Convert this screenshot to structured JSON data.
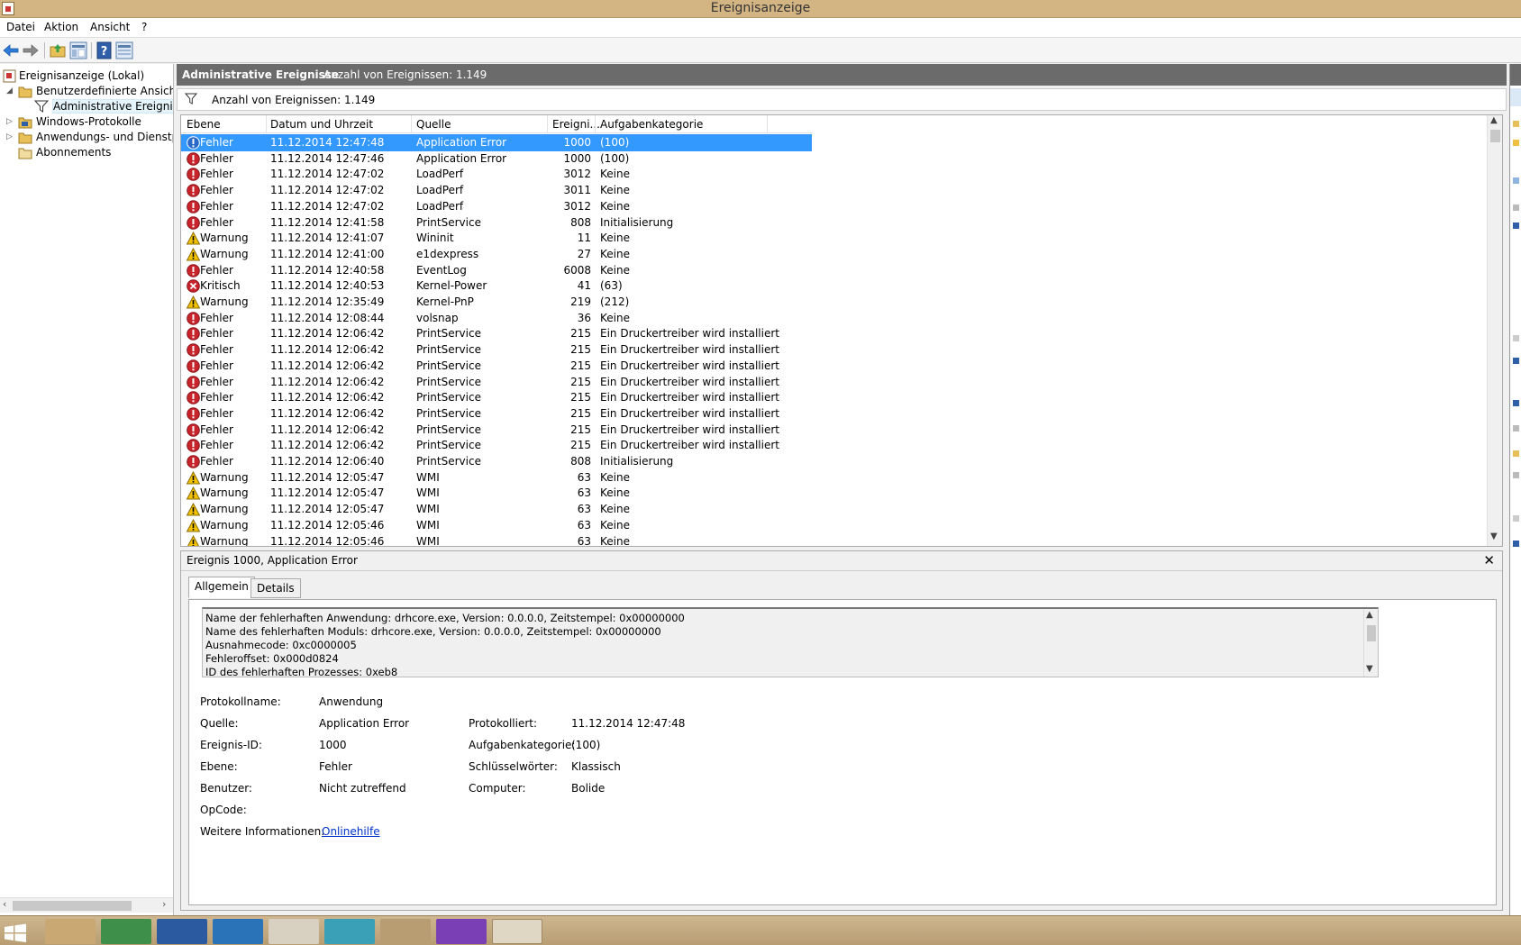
{
  "window": {
    "title": "Ereignisanzeige"
  },
  "menu": [
    "Datei",
    "Aktion",
    "Ansicht",
    "?"
  ],
  "toolbar": {
    "buttons": [
      "back-arrow-icon",
      "forward-arrow-icon",
      "folder-up-icon",
      "show-hide-tree-icon",
      "help-icon",
      "properties-icon"
    ]
  },
  "tree": {
    "root": "Ereignisanzeige (Lokal)",
    "custom_views": "Benutzerdefinierte Ansichten",
    "admin_events": "Administrative Ereignisse",
    "windows_logs": "Windows-Protokolle",
    "app_services": "Anwendungs- und Dienstpro",
    "subscriptions": "Abonnements"
  },
  "center": {
    "header_title": "Administrative Ereignisse",
    "header_count": "Anzahl von Ereignissen: 1.149",
    "filter_text": "Anzahl von Ereignissen: 1.149"
  },
  "columns": [
    "Ebene",
    "Datum und Uhrzeit",
    "Quelle",
    "Ereigni...",
    "Aufgabenkategorie"
  ],
  "events": [
    {
      "level": "Fehler",
      "type": "info-sel",
      "date": "11.12.2014 12:47:48",
      "source": "Application Error",
      "id": "1000",
      "category": "(100)"
    },
    {
      "level": "Fehler",
      "type": "error",
      "date": "11.12.2014 12:47:46",
      "source": "Application Error",
      "id": "1000",
      "category": "(100)"
    },
    {
      "level": "Fehler",
      "type": "error",
      "date": "11.12.2014 12:47:02",
      "source": "LoadPerf",
      "id": "3012",
      "category": "Keine"
    },
    {
      "level": "Fehler",
      "type": "error",
      "date": "11.12.2014 12:47:02",
      "source": "LoadPerf",
      "id": "3011",
      "category": "Keine"
    },
    {
      "level": "Fehler",
      "type": "error",
      "date": "11.12.2014 12:47:02",
      "source": "LoadPerf",
      "id": "3012",
      "category": "Keine"
    },
    {
      "level": "Fehler",
      "type": "error",
      "date": "11.12.2014 12:41:58",
      "source": "PrintService",
      "id": "808",
      "category": "Initialisierung"
    },
    {
      "level": "Warnung",
      "type": "warning",
      "date": "11.12.2014 12:41:07",
      "source": "Wininit",
      "id": "11",
      "category": "Keine"
    },
    {
      "level": "Warnung",
      "type": "warning",
      "date": "11.12.2014 12:41:00",
      "source": "e1dexpress",
      "id": "27",
      "category": "Keine"
    },
    {
      "level": "Fehler",
      "type": "error",
      "date": "11.12.2014 12:40:58",
      "source": "EventLog",
      "id": "6008",
      "category": "Keine"
    },
    {
      "level": "Kritisch",
      "type": "critical",
      "date": "11.12.2014 12:40:53",
      "source": "Kernel-Power",
      "id": "41",
      "category": "(63)"
    },
    {
      "level": "Warnung",
      "type": "warning",
      "date": "11.12.2014 12:35:49",
      "source": "Kernel-PnP",
      "id": "219",
      "category": "(212)"
    },
    {
      "level": "Fehler",
      "type": "error",
      "date": "11.12.2014 12:08:44",
      "source": "volsnap",
      "id": "36",
      "category": "Keine"
    },
    {
      "level": "Fehler",
      "type": "error",
      "date": "11.12.2014 12:06:42",
      "source": "PrintService",
      "id": "215",
      "category": "Ein Druckertreiber wird installiert"
    },
    {
      "level": "Fehler",
      "type": "error",
      "date": "11.12.2014 12:06:42",
      "source": "PrintService",
      "id": "215",
      "category": "Ein Druckertreiber wird installiert"
    },
    {
      "level": "Fehler",
      "type": "error",
      "date": "11.12.2014 12:06:42",
      "source": "PrintService",
      "id": "215",
      "category": "Ein Druckertreiber wird installiert"
    },
    {
      "level": "Fehler",
      "type": "error",
      "date": "11.12.2014 12:06:42",
      "source": "PrintService",
      "id": "215",
      "category": "Ein Druckertreiber wird installiert"
    },
    {
      "level": "Fehler",
      "type": "error",
      "date": "11.12.2014 12:06:42",
      "source": "PrintService",
      "id": "215",
      "category": "Ein Druckertreiber wird installiert"
    },
    {
      "level": "Fehler",
      "type": "error",
      "date": "11.12.2014 12:06:42",
      "source": "PrintService",
      "id": "215",
      "category": "Ein Druckertreiber wird installiert"
    },
    {
      "level": "Fehler",
      "type": "error",
      "date": "11.12.2014 12:06:42",
      "source": "PrintService",
      "id": "215",
      "category": "Ein Druckertreiber wird installiert"
    },
    {
      "level": "Fehler",
      "type": "error",
      "date": "11.12.2014 12:06:42",
      "source": "PrintService",
      "id": "215",
      "category": "Ein Druckertreiber wird installiert"
    },
    {
      "level": "Fehler",
      "type": "error",
      "date": "11.12.2014 12:06:40",
      "source": "PrintService",
      "id": "808",
      "category": "Initialisierung"
    },
    {
      "level": "Warnung",
      "type": "warning",
      "date": "11.12.2014 12:05:47",
      "source": "WMI",
      "id": "63",
      "category": "Keine"
    },
    {
      "level": "Warnung",
      "type": "warning",
      "date": "11.12.2014 12:05:47",
      "source": "WMI",
      "id": "63",
      "category": "Keine"
    },
    {
      "level": "Warnung",
      "type": "warning",
      "date": "11.12.2014 12:05:47",
      "source": "WMI",
      "id": "63",
      "category": "Keine"
    },
    {
      "level": "Warnung",
      "type": "warning",
      "date": "11.12.2014 12:05:46",
      "source": "WMI",
      "id": "63",
      "category": "Keine"
    },
    {
      "level": "Warnung",
      "type": "warning",
      "date": "11.12.2014 12:05:46",
      "source": "WMI",
      "id": "63",
      "category": "Keine"
    }
  ],
  "detail": {
    "title": "Ereignis 1000, Application Error",
    "tabs": [
      "Allgemein",
      "Details"
    ],
    "description": [
      "Name der fehlerhaften Anwendung: drhcore.exe, Version: 0.0.0.0, Zeitstempel: 0x00000000",
      "Name des fehlerhaften Moduls: drhcore.exe, Version: 0.0.0.0, Zeitstempel: 0x00000000",
      "Ausnahmecode: 0xc0000005",
      "Fehleroffset: 0x000d0824",
      "ID des fehlerhaften Prozesses: 0xeb8"
    ],
    "labels": {
      "log_name": "Protokollname:",
      "source": "Quelle:",
      "event_id": "Ereignis-ID:",
      "level": "Ebene:",
      "user": "Benutzer:",
      "opcode": "OpCode:",
      "more_info": "Weitere Informationen:",
      "logged": "Protokolliert:",
      "task_category": "Aufgabenkategorie:",
      "keywords": "Schlüsselwörter:",
      "computer": "Computer:"
    },
    "values": {
      "log_name": "Anwendung",
      "source": "Application Error",
      "event_id": "1000",
      "level": "Fehler",
      "user": "Nicht zutreffend",
      "opcode": "",
      "more_info": "Onlinehilfe",
      "logged": "11.12.2014 12:47:48",
      "task_category": "(100)",
      "keywords": "Klassisch",
      "computer": "Bolide"
    }
  },
  "colors": {
    "selection": "#3399ff",
    "header_bg": "#6b6b6b",
    "error": "#c8242b",
    "warning": "#f2c200",
    "info": "#2a6acb"
  }
}
